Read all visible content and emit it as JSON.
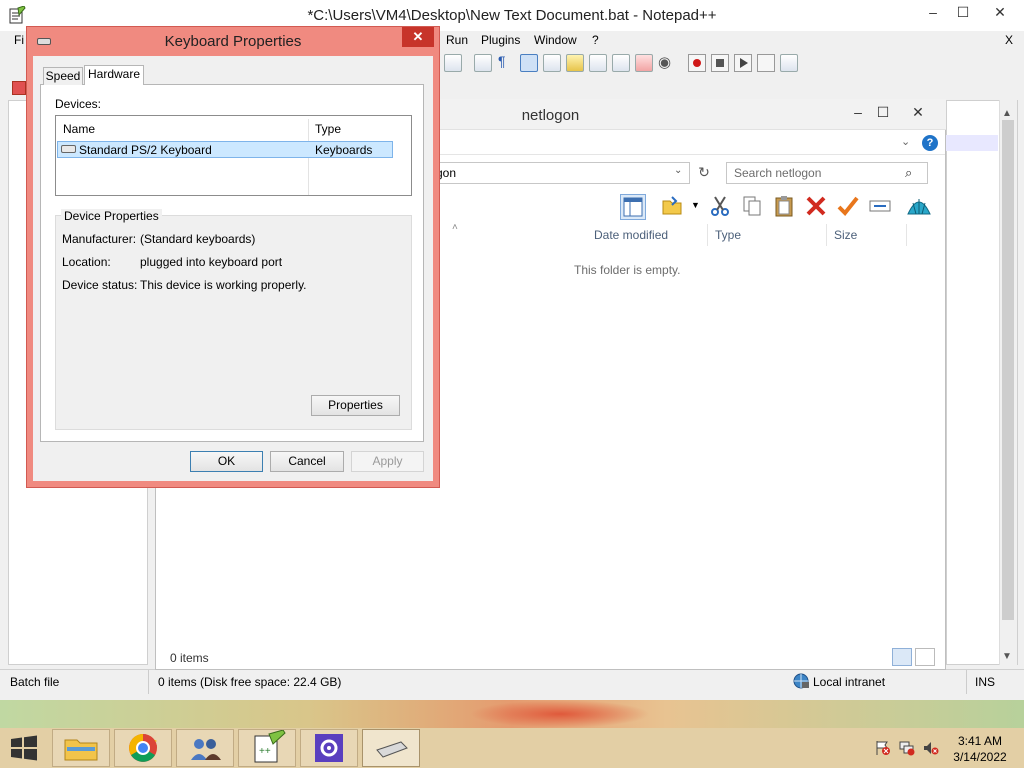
{
  "notepad": {
    "title": "*C:\\Users\\VM4\\Desktop\\New Text Document.bat - Notepad++",
    "minimize": "–",
    "maximize": "☐",
    "close": "✕",
    "menu_close": "X",
    "menu": [
      "Fi",
      "Run",
      "Plugins",
      "Window",
      "?"
    ],
    "status_left": "Batch file",
    "status_right": "INS"
  },
  "explorer": {
    "title": "netlogon",
    "minimize": "–",
    "maximize": "☐",
    "close": "✕",
    "help": "?",
    "address_tail": "gon",
    "search_placeholder": "Search netlogon",
    "columns": [
      "Date modified",
      "Type",
      "Size"
    ],
    "empty_message": "This folder is empty.",
    "item_count": "0 items",
    "status_text": "0 items (Disk free space: 22.4 GB)",
    "zone": "Local intranet"
  },
  "dialog": {
    "title": "Keyboard Properties",
    "close": "✕",
    "tabs": [
      "Speed",
      "Hardware"
    ],
    "devices_label": "Devices:",
    "device_columns": [
      "Name",
      "Type"
    ],
    "devices": [
      {
        "name": "Standard PS/2 Keyboard",
        "type": "Keyboards"
      }
    ],
    "device_properties_label": "Device Properties",
    "properties": [
      {
        "label": "Manufacturer:",
        "value": "(Standard keyboards)"
      },
      {
        "label": "Location:",
        "value": "plugged into keyboard port"
      },
      {
        "label": "Device status:",
        "value": "This device is working properly."
      }
    ],
    "properties_button": "Properties",
    "ok": "OK",
    "cancel": "Cancel",
    "apply": "Apply"
  },
  "taskbar": {
    "time": "3:41 AM",
    "date": "3/14/2022"
  },
  "colors": {
    "dialog_frame": "#f08a80",
    "dialog_close": "#c7342a",
    "selection": "#cce8ff",
    "taskbar": "#e3cfa5"
  }
}
